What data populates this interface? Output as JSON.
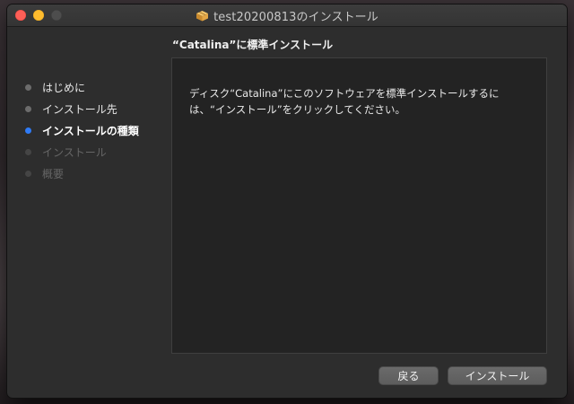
{
  "window": {
    "title": "test20200813のインストール",
    "icon": "package-icon",
    "traffic_lights": {
      "close_color": "#fe5f57",
      "minimize_color": "#febc2e",
      "zoom_color": "#4d4d4d"
    }
  },
  "header": {
    "title": "“Catalina”に標準インストール"
  },
  "sidebar": {
    "steps": [
      {
        "label": "はじめに",
        "state": "done"
      },
      {
        "label": "インストール先",
        "state": "done"
      },
      {
        "label": "インストールの種類",
        "state": "current"
      },
      {
        "label": "インストール",
        "state": "pending"
      },
      {
        "label": "概要",
        "state": "pending"
      }
    ],
    "current_color": "#2f7bf6"
  },
  "content": {
    "line1": "ディスク“Catalina”にこのソフトウェアを標準インストールするに",
    "line2": "は、“インストール”をクリックしてください。"
  },
  "buttons": {
    "back_label": "戻る",
    "install_label": "インストール"
  }
}
